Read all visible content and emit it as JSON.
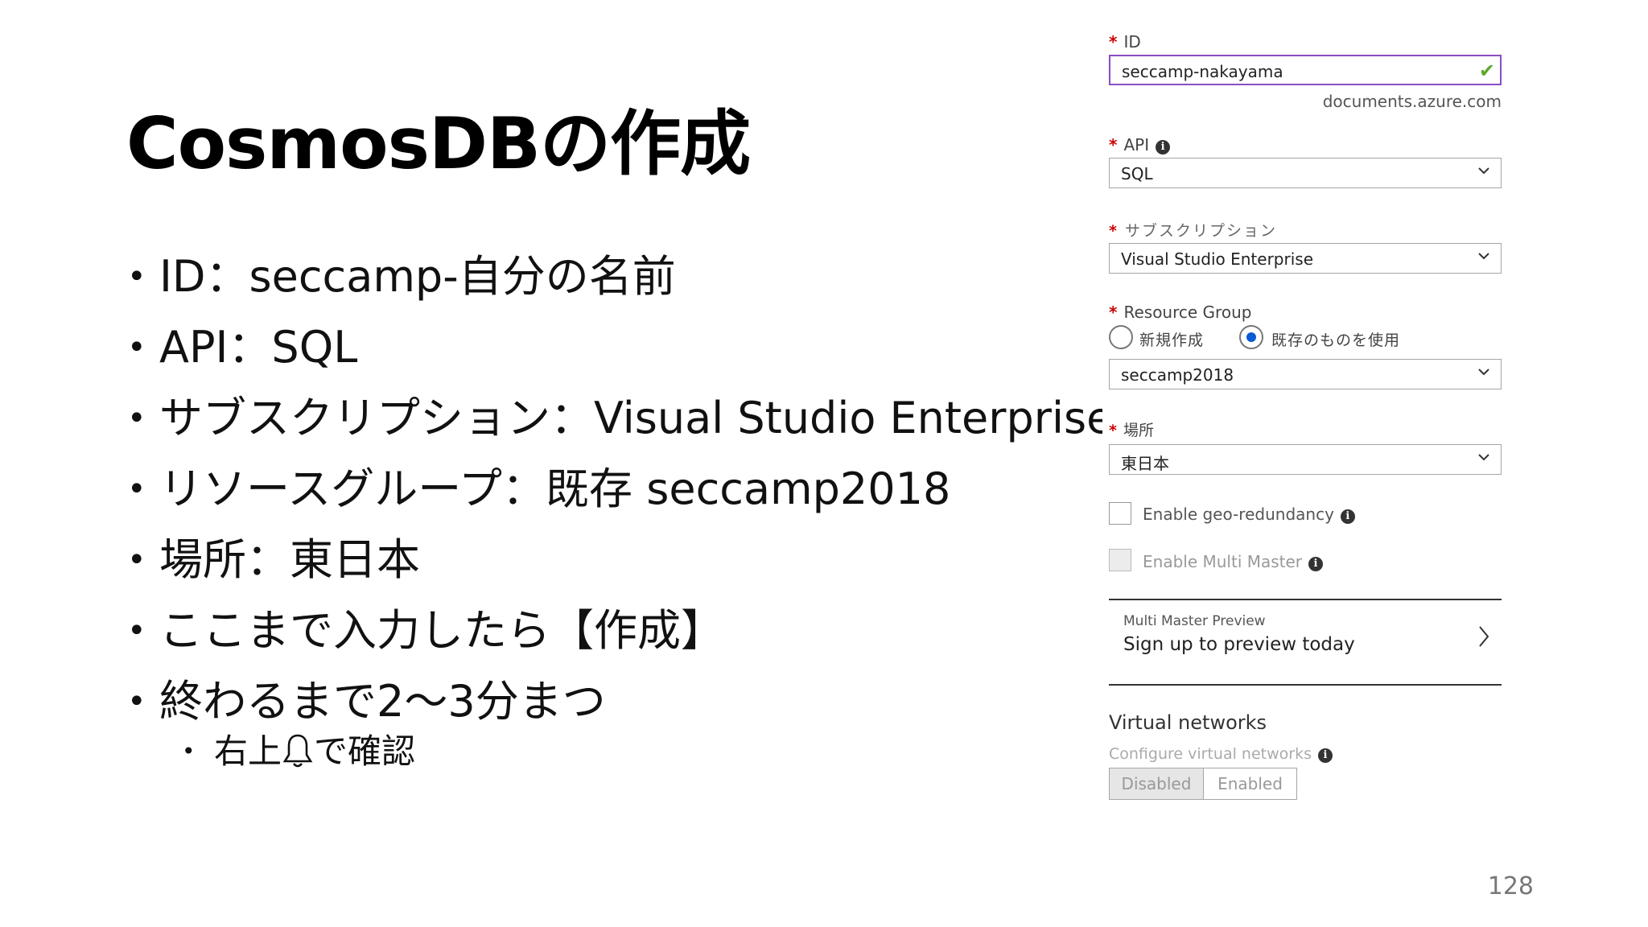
{
  "slide": {
    "title": "CosmosDBの作成",
    "bullets": [
      "ID：seccamp-自分の名前",
      "API：SQL",
      "サブスクリプション：Visual Studio Enterprise",
      "リソースグループ：既存 seccamp2018",
      "場所：東日本",
      "ここまで入力したら【作成】",
      "終わるまで2～3分まつ"
    ],
    "sub_bullet": {
      "before": "右上",
      "after": "で確認"
    },
    "page_number": "128"
  },
  "form": {
    "id": {
      "label": "ID",
      "value": "seccamp-nakayama",
      "suffix": "documents.azure.com"
    },
    "api": {
      "label": "API",
      "value": "SQL"
    },
    "subscription": {
      "label": "サブスクリプション",
      "value": "Visual Studio Enterprise"
    },
    "resource_group": {
      "label": "Resource Group",
      "options": [
        "新規作成",
        "既存のものを使用"
      ],
      "selected": "既存のものを使用",
      "value": "seccamp2018"
    },
    "location": {
      "label": "場所",
      "value": "東日本"
    },
    "geo_redundancy": {
      "label": "Enable geo-redundancy"
    },
    "multi_master": {
      "label": "Enable Multi Master"
    },
    "preview": {
      "caption": "Multi Master Preview",
      "link": "Sign up to preview today"
    },
    "vnet": {
      "heading": "Virtual networks",
      "sub": "Configure virtual networks",
      "options": [
        "Disabled",
        "Enabled"
      ],
      "selected": "Disabled"
    }
  },
  "colors": {
    "accent": "#8a4dc4",
    "radio_selected": "#0a59d6",
    "valid_check": "#5fa82b",
    "required": "#cc0000"
  }
}
